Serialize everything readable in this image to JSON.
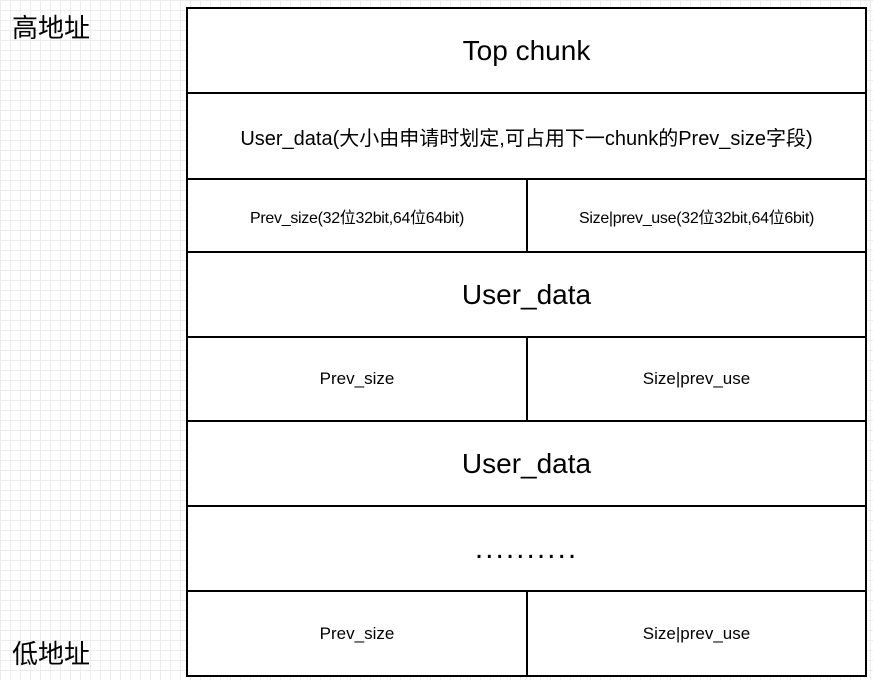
{
  "labels": {
    "high_address": "高地址",
    "low_address": "低地址"
  },
  "blocks": {
    "top_chunk": "Top chunk",
    "user_data_1": "User_data(大小由申请时划定,可占用下一chunk的Prev_size字段)",
    "prev_size_1": "Prev_size(32位32bit,64位64bit)",
    "size_prev_use_1": "Size|prev_use(32位32bit,64位6bit)",
    "user_data_2": "User_data",
    "prev_size_2": "Prev_size",
    "size_prev_use_2": "Size|prev_use",
    "user_data_3": "User_data",
    "ellipsis": "..........",
    "prev_size_3": "Prev_size",
    "size_prev_use_3": "Size|prev_use"
  }
}
